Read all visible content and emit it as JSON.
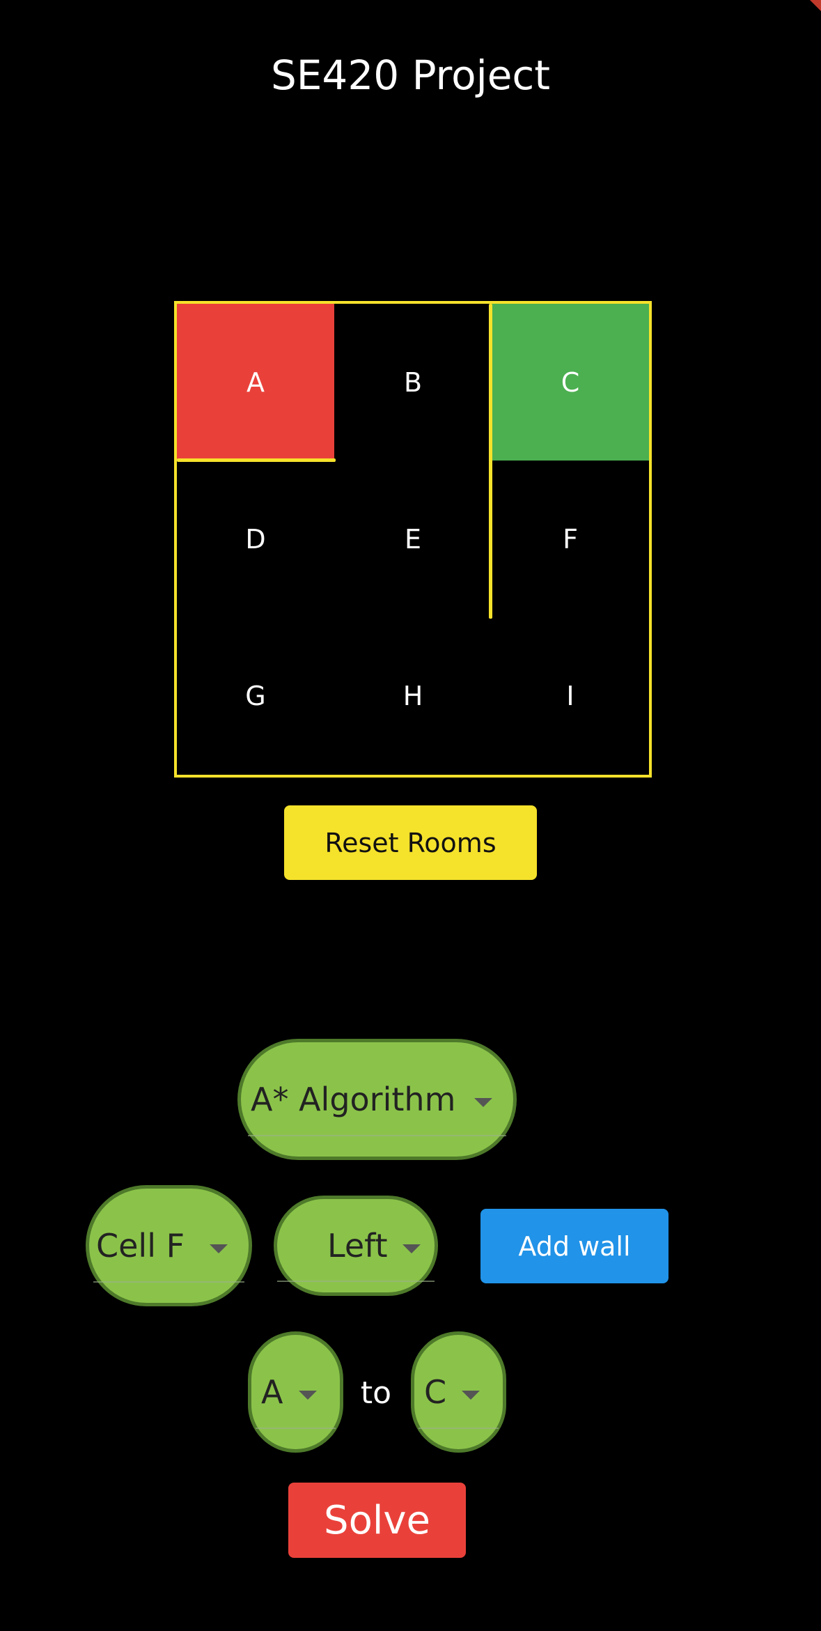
{
  "app": {
    "title": "SE420 Project"
  },
  "grid": {
    "cells": [
      {
        "label": "A",
        "color": "#e9413a"
      },
      {
        "label": "B",
        "color": "#000000"
      },
      {
        "label": "C",
        "color": "#4caf50"
      },
      {
        "label": "D",
        "color": "#000000"
      },
      {
        "label": "E",
        "color": "#000000"
      },
      {
        "label": "F",
        "color": "#000000"
      },
      {
        "label": "G",
        "color": "#000000"
      },
      {
        "label": "H",
        "color": "#000000"
      },
      {
        "label": "I",
        "color": "#000000"
      }
    ],
    "wall_color": "#f5e22b"
  },
  "controls": {
    "reset_label": "Reset Rooms",
    "algorithm_value": "A* Algorithm",
    "cell_value": "Cell F",
    "side_value": "Left",
    "add_wall_label": "Add wall",
    "start_value": "A",
    "to_label": "to",
    "end_value": "C",
    "solve_label": "Solve"
  },
  "colors": {
    "accent_yellow": "#f5e22b",
    "dropdown_green": "#8bc34a",
    "add_blue": "#2193e8",
    "solve_red": "#e9413a",
    "start_red": "#e9413a",
    "goal_green": "#4caf50"
  }
}
